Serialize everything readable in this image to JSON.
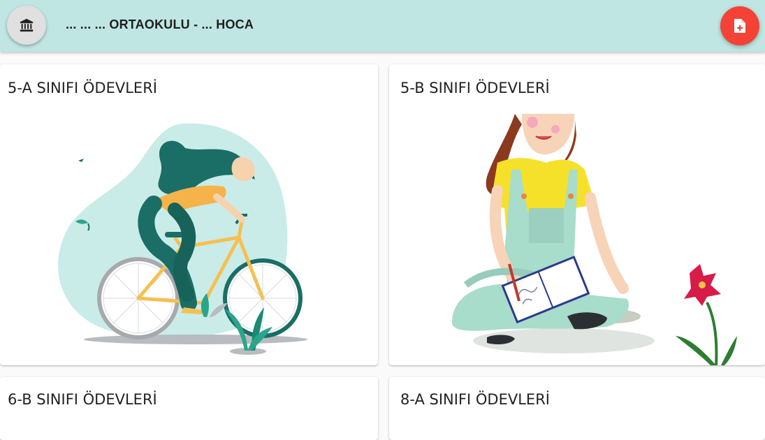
{
  "header": {
    "title": "... ... ... ORTAOKULU - ... HOCA",
    "home_icon": "institution-icon",
    "action_icon": "file-add-icon",
    "background": "#bfe6e2",
    "fab_color": "#f44336"
  },
  "cards": [
    {
      "title": "5-A SINIFI ÖDEVLERİ",
      "image": "girl-riding-bicycle-illustration"
    },
    {
      "title": "5-B SINIFI ÖDEVLERİ",
      "image": "girl-writing-notebook-illustration"
    },
    {
      "title": "6-B SINIFI ÖDEVLERİ"
    },
    {
      "title": "8-A SINIFI ÖDEVLERİ"
    }
  ]
}
